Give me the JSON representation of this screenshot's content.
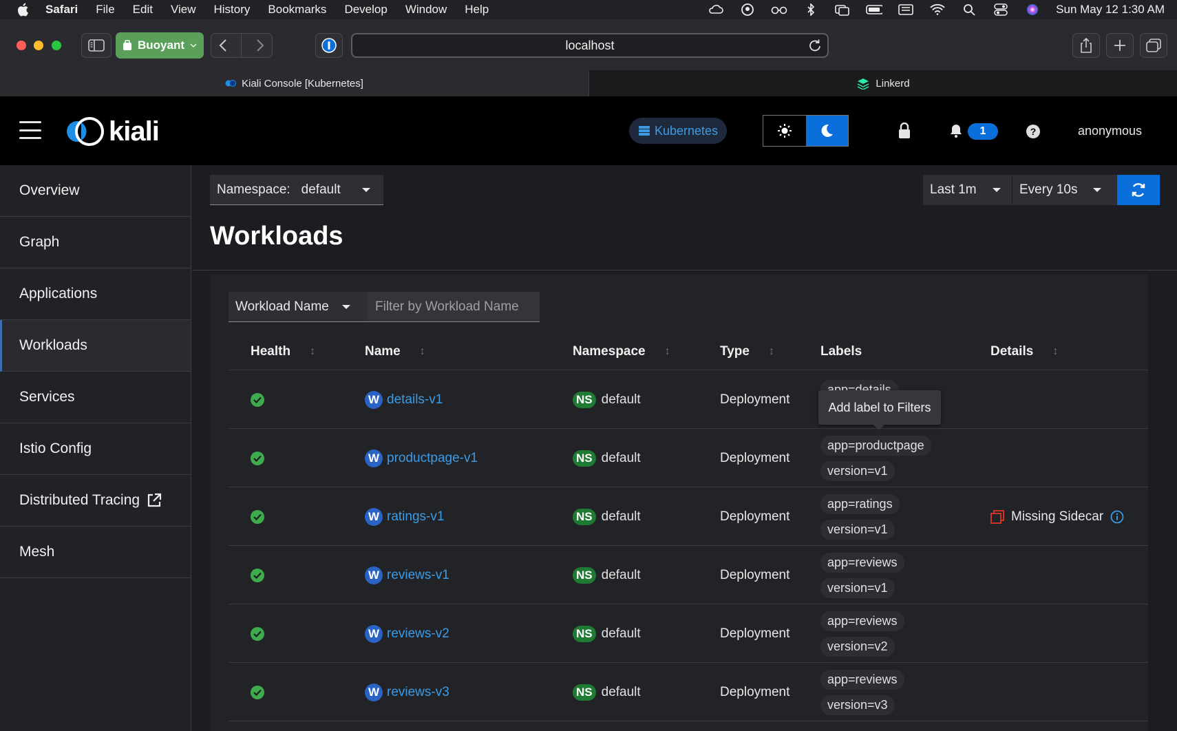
{
  "menubar": {
    "app": "Safari",
    "items": [
      "File",
      "Edit",
      "View",
      "History",
      "Bookmarks",
      "Develop",
      "Window",
      "Help"
    ],
    "clock": "Sun May 12  1:30 AM"
  },
  "browser": {
    "profile": "Buoyant",
    "url": "localhost",
    "tabs": [
      {
        "label": "Kiali Console [Kubernetes]"
      },
      {
        "label": "Linkerd"
      }
    ]
  },
  "header": {
    "logo": "kiali",
    "cluster": "Kubernetes",
    "notifications": "1",
    "user": "anonymous"
  },
  "sidebar": {
    "items": [
      {
        "label": "Overview"
      },
      {
        "label": "Graph"
      },
      {
        "label": "Applications"
      },
      {
        "label": "Workloads"
      },
      {
        "label": "Services"
      },
      {
        "label": "Istio Config"
      },
      {
        "label": "Distributed Tracing"
      },
      {
        "label": "Mesh"
      }
    ]
  },
  "toolbar": {
    "namespace_label": "Namespace:",
    "namespace_value": "default",
    "time_range": "Last 1m",
    "refresh_interval": "Every 10s"
  },
  "page": {
    "title": "Workloads"
  },
  "filter": {
    "type": "Workload Name",
    "placeholder": "Filter by Workload Name"
  },
  "table": {
    "headers": {
      "health": "Health",
      "name": "Name",
      "namespace": "Namespace",
      "type": "Type",
      "labels": "Labels",
      "details": "Details"
    },
    "rows": [
      {
        "name": "details-v1",
        "ns_badge": "NS",
        "namespace": "default",
        "type": "Deployment",
        "labels": [
          "app=details"
        ],
        "details": ""
      },
      {
        "name": "productpage-v1",
        "ns_badge": "NS",
        "namespace": "default",
        "type": "Deployment",
        "labels": [
          "app=productpage",
          "version=v1"
        ],
        "details": ""
      },
      {
        "name": "ratings-v1",
        "ns_badge": "NS",
        "namespace": "default",
        "type": "Deployment",
        "labels": [
          "app=ratings",
          "version=v1"
        ],
        "details": "Missing Sidecar"
      },
      {
        "name": "reviews-v1",
        "ns_badge": "NS",
        "namespace": "default",
        "type": "Deployment",
        "labels": [
          "app=reviews",
          "version=v1"
        ],
        "details": ""
      },
      {
        "name": "reviews-v2",
        "ns_badge": "NS",
        "namespace": "default",
        "type": "Deployment",
        "labels": [
          "app=reviews",
          "version=v2"
        ],
        "details": ""
      },
      {
        "name": "reviews-v3",
        "ns_badge": "NS",
        "namespace": "default",
        "type": "Deployment",
        "labels": [
          "app=reviews",
          "version=v3"
        ],
        "details": ""
      }
    ],
    "workload_badge": "W"
  },
  "tooltip": {
    "text": "Add label to Filters"
  },
  "colors": {
    "accent": "#0a6edb",
    "link": "#3d9be6",
    "healthy": "#3eab4c",
    "ns_badge": "#1f7a34",
    "warning": "#e0362b"
  }
}
